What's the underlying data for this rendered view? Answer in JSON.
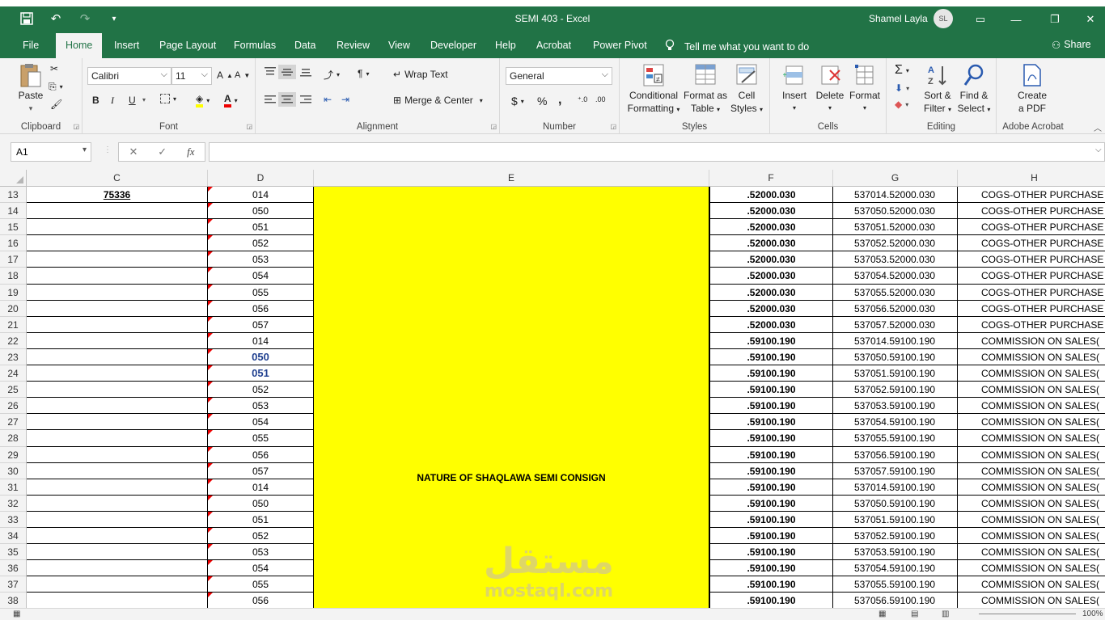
{
  "window": {
    "title": "SEMI 403  -  Excel",
    "user_name": "Shamel Layla",
    "user_initials": "SL"
  },
  "tabs": [
    "File",
    "Home",
    "Insert",
    "Page Layout",
    "Formulas",
    "Data",
    "Review",
    "View",
    "Developer",
    "Help",
    "Acrobat",
    "Power Pivot"
  ],
  "tell_me": "Tell me what you want to do",
  "share": "Share",
  "ribbon": {
    "clipboard": {
      "paste": "Paste",
      "label": "Clipboard"
    },
    "font": {
      "name": "Calibri",
      "size": "11",
      "bold": "B",
      "italic": "I",
      "underline": "U",
      "label": "Font"
    },
    "alignment": {
      "wrap": "Wrap Text",
      "merge": "Merge & Center",
      "label": "Alignment"
    },
    "number": {
      "format": "General",
      "currency": "$",
      "percent": "%",
      "comma": ",",
      "label": "Number"
    },
    "styles": {
      "conditional": [
        "Conditional",
        "Formatting"
      ],
      "format_table": [
        "Format as",
        "Table"
      ],
      "cell_styles": [
        "Cell",
        "Styles"
      ],
      "label": "Styles"
    },
    "cells": {
      "insert": "Insert",
      "delete": "Delete",
      "format": "Format",
      "label": "Cells"
    },
    "editing": {
      "sort": [
        "Sort &",
        "Filter"
      ],
      "find": [
        "Find &",
        "Select"
      ],
      "label": "Editing"
    },
    "acrobat": {
      "create": [
        "Create",
        "a PDF"
      ],
      "label": "Adobe Acrobat"
    }
  },
  "formula_bar": {
    "name_box": "A1",
    "fx": "fx",
    "value": ""
  },
  "columns": [
    "C",
    "D",
    "E",
    "F",
    "G",
    "H"
  ],
  "merged_e_label": "NATURE OF SHAQLAWA SEMI CONSIGN",
  "watermark": {
    "arabic": "مستقل",
    "latin": "mostaql.com"
  },
  "rows": [
    {
      "n": "13",
      "c": "75336",
      "d": "014",
      "f": ".52000.030",
      "g": "537014.52000.030",
      "h": "COGS-OTHER PURCHASE"
    },
    {
      "n": "14",
      "c": "",
      "d": "050",
      "f": ".52000.030",
      "g": "537050.52000.030",
      "h": "COGS-OTHER PURCHASE"
    },
    {
      "n": "15",
      "c": "",
      "d": "051",
      "f": ".52000.030",
      "g": "537051.52000.030",
      "h": "COGS-OTHER PURCHASE"
    },
    {
      "n": "16",
      "c": "",
      "d": "052",
      "f": ".52000.030",
      "g": "537052.52000.030",
      "h": "COGS-OTHER PURCHASE"
    },
    {
      "n": "17",
      "c": "",
      "d": "053",
      "f": ".52000.030",
      "g": "537053.52000.030",
      "h": "COGS-OTHER PURCHASE"
    },
    {
      "n": "18",
      "c": "",
      "d": "054",
      "f": ".52000.030",
      "g": "537054.52000.030",
      "h": "COGS-OTHER PURCHASE"
    },
    {
      "n": "19",
      "c": "",
      "d": "055",
      "f": ".52000.030",
      "g": "537055.52000.030",
      "h": "COGS-OTHER PURCHASE"
    },
    {
      "n": "20",
      "c": "",
      "d": "056",
      "f": ".52000.030",
      "g": "537056.52000.030",
      "h": "COGS-OTHER PURCHASE"
    },
    {
      "n": "21",
      "c": "",
      "d": "057",
      "f": ".52000.030",
      "g": "537057.52000.030",
      "h": "COGS-OTHER PURCHASE"
    },
    {
      "n": "22",
      "c": "",
      "d": "014",
      "f": ".59100.190",
      "g": "537014.59100.190",
      "h": "COMMISSION ON SALES("
    },
    {
      "n": "23",
      "c": "",
      "d": "050",
      "f": ".59100.190",
      "g": "537050.59100.190",
      "h": "COMMISSION ON SALES(",
      "blue": true
    },
    {
      "n": "24",
      "c": "",
      "d": "051",
      "f": ".59100.190",
      "g": "537051.59100.190",
      "h": "COMMISSION ON SALES(",
      "blue": true
    },
    {
      "n": "25",
      "c": "",
      "d": "052",
      "f": ".59100.190",
      "g": "537052.59100.190",
      "h": "COMMISSION ON SALES("
    },
    {
      "n": "26",
      "c": "",
      "d": "053",
      "f": ".59100.190",
      "g": "537053.59100.190",
      "h": "COMMISSION ON SALES("
    },
    {
      "n": "27",
      "c": "",
      "d": "054",
      "f": ".59100.190",
      "g": "537054.59100.190",
      "h": "COMMISSION ON SALES("
    },
    {
      "n": "28",
      "c": "",
      "d": "055",
      "f": ".59100.190",
      "g": "537055.59100.190",
      "h": "COMMISSION ON SALES("
    },
    {
      "n": "29",
      "c": "",
      "d": "056",
      "f": ".59100.190",
      "g": "537056.59100.190",
      "h": "COMMISSION ON SALES("
    },
    {
      "n": "30",
      "c": "",
      "d": "057",
      "f": ".59100.190",
      "g": "537057.59100.190",
      "h": "COMMISSION ON SALES("
    },
    {
      "n": "31",
      "c": "",
      "d": "014",
      "f": ".59100.190",
      "g": "537014.59100.190",
      "h": "COMMISSION ON SALES("
    },
    {
      "n": "32",
      "c": "",
      "d": "050",
      "f": ".59100.190",
      "g": "537050.59100.190",
      "h": "COMMISSION ON SALES("
    },
    {
      "n": "33",
      "c": "",
      "d": "051",
      "f": ".59100.190",
      "g": "537051.59100.190",
      "h": "COMMISSION ON SALES("
    },
    {
      "n": "34",
      "c": "",
      "d": "052",
      "f": ".59100.190",
      "g": "537052.59100.190",
      "h": "COMMISSION ON SALES("
    },
    {
      "n": "35",
      "c": "",
      "d": "053",
      "f": ".59100.190",
      "g": "537053.59100.190",
      "h": "COMMISSION ON SALES("
    },
    {
      "n": "36",
      "c": "",
      "d": "054",
      "f": ".59100.190",
      "g": "537054.59100.190",
      "h": "COMMISSION ON SALES("
    },
    {
      "n": "37",
      "c": "",
      "d": "055",
      "f": ".59100.190",
      "g": "537055.59100.190",
      "h": "COMMISSION ON SALES("
    },
    {
      "n": "38",
      "c": "",
      "d": "056",
      "f": ".59100.190",
      "g": "537056.59100.190",
      "h": "COMMISSION ON SALES("
    }
  ],
  "status": {
    "zoom": "100%"
  },
  "colors": {
    "excel_green": "#217346",
    "highlight_yellow": "#ffff00",
    "comment_flag": "#e00000"
  }
}
